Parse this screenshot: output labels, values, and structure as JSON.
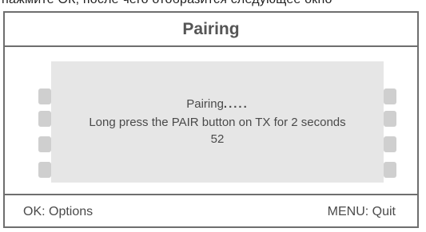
{
  "caption": "нажмите ОК, после чего отобразится следующее окно",
  "screen": {
    "title": "Pairing",
    "dialog": {
      "status_label": "Pairing",
      "status_dots": ".....",
      "instruction": "Long press the PAIR button on TX for 2 seconds",
      "countdown": "52"
    },
    "footer": {
      "ok_hint": "OK: Options",
      "menu_hint": "MENU: Quit"
    }
  },
  "colors": {
    "frame_border": "#6e6e6e",
    "dialog_bg": "#e6e6e6",
    "side_tab": "#cfcfcf",
    "text": "#4a4a4a"
  }
}
